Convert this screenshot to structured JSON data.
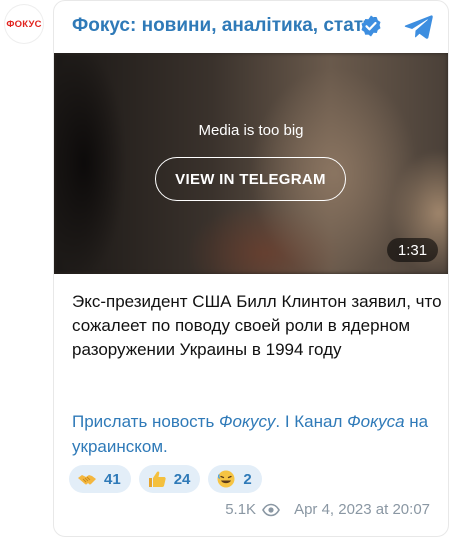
{
  "avatar": {
    "text": "ФОКУС"
  },
  "header": {
    "channel_name": "Фокус: новини, аналітика, статті"
  },
  "media": {
    "message": "Media is too big",
    "button_label": "VIEW IN TELEGRAM",
    "duration": "1:31"
  },
  "post": {
    "text": "Экс-президент США Билл Клинтон заявил, что сожалеет по поводу своей роли в ядерном разоружении Украины в 1994 году"
  },
  "links": {
    "link1_prefix": "Прислать новость ",
    "link1_italic": "Фокусу",
    "link1_suffix": ".",
    "separator": " I ",
    "link2_prefix": "Канал ",
    "link2_italic": "Фокуса",
    "link2_suffix": " на украинском."
  },
  "reactions": [
    {
      "icon": "handshake-emoji",
      "count": "41"
    },
    {
      "icon": "thumbs-up-emoji",
      "count": "24"
    },
    {
      "icon": "rofl-emoji",
      "count": "2"
    }
  ],
  "meta": {
    "views": "5.1K",
    "date": "Apr 4, 2023 at 20:07"
  },
  "colors": {
    "link": "#2f7ab8",
    "brand_red": "#e1231e",
    "reaction_bg": "#e3eef8"
  }
}
